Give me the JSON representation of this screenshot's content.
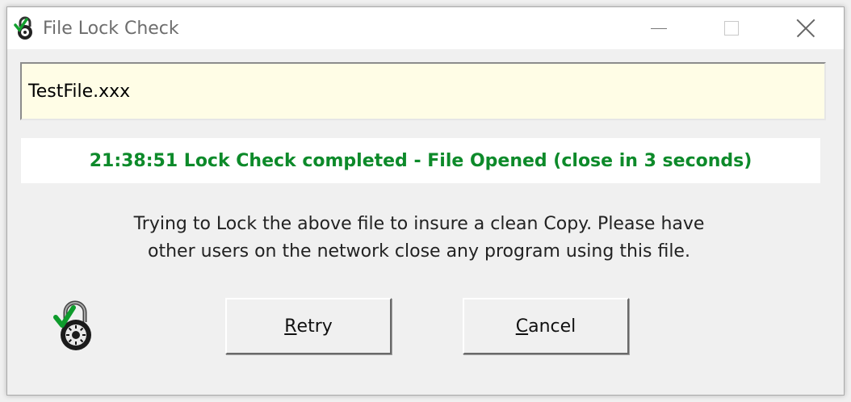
{
  "window": {
    "title": "File Lock Check",
    "controls": {
      "minimize": "minimize",
      "maximize": "maximize",
      "close": "close"
    }
  },
  "file": {
    "name": "TestFile.xxx"
  },
  "status": {
    "text": "21:38:51 Lock Check completed - File Opened (close in 3 seconds)",
    "color": "#0d8a2a"
  },
  "message": {
    "line1": "Trying to Lock the above file to insure a clean Copy. Please have",
    "line2": "other users on the network close any program using this file."
  },
  "buttons": {
    "retry": {
      "mnemonic": "R",
      "rest": "etry"
    },
    "cancel": {
      "mnemonic": "C",
      "rest": "ancel"
    }
  },
  "icons": {
    "app": "lock-check-icon",
    "status": "lock-check-icon"
  }
}
